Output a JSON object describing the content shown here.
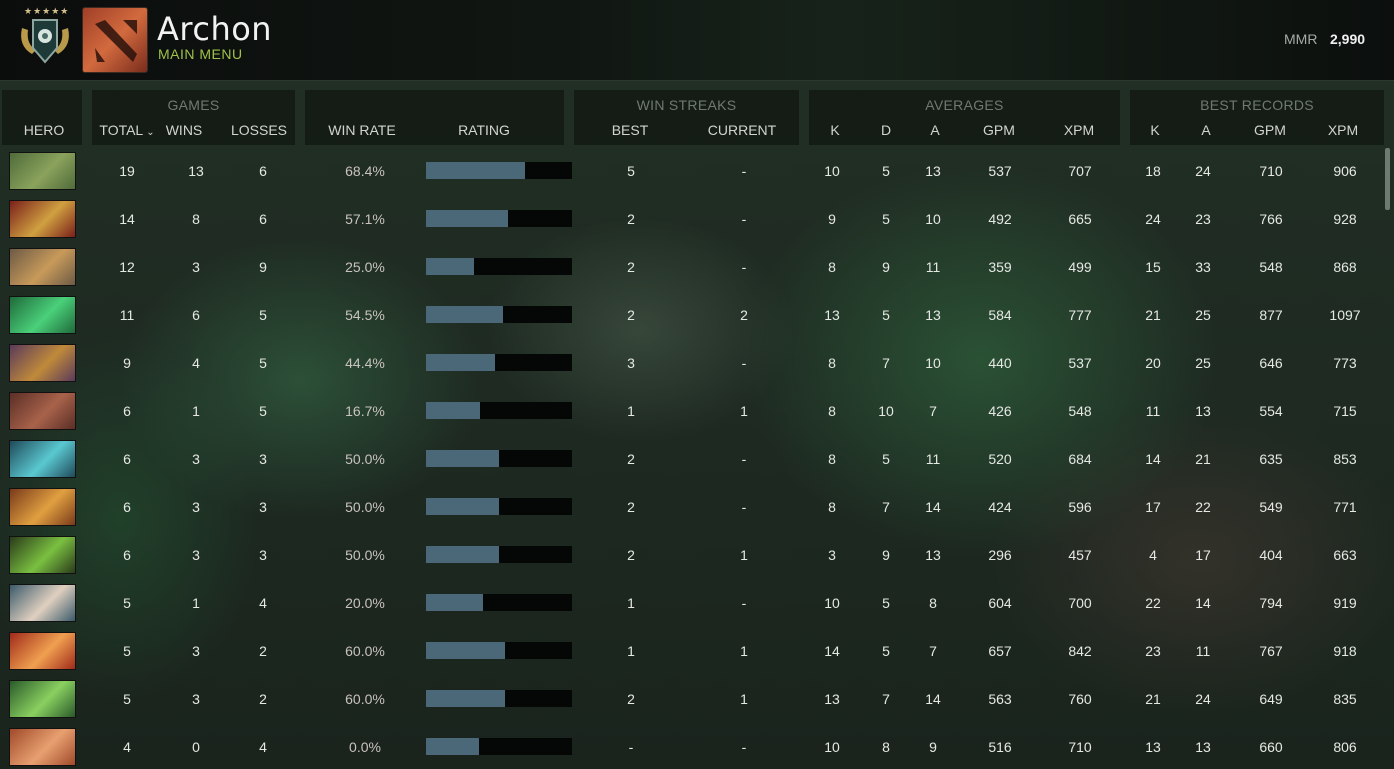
{
  "header": {
    "title": "Archon",
    "subtitle": "MAIN MENU",
    "mmr_label": "MMR",
    "mmr_value": "2,990",
    "rank_badge_icon": "rank-medal-icon",
    "app_icon": "dota-logo-icon"
  },
  "groups": {
    "games": "GAMES",
    "win_streaks": "WIN STREAKS",
    "averages": "AVERAGES",
    "best_records": "BEST RECORDS"
  },
  "columns": {
    "hero": "HERO",
    "total": "TOTAL",
    "wins": "WINS",
    "losses": "LOSSES",
    "win_rate": "WIN RATE",
    "rating": "RATING",
    "best": "BEST",
    "current": "CURRENT",
    "avg_k": "K",
    "avg_d": "D",
    "avg_a": "A",
    "avg_gpm": "GPM",
    "avg_xpm": "XPM",
    "best_k": "K",
    "best_a": "A",
    "best_gpm": "GPM",
    "best_xpm": "XPM"
  },
  "colors": {
    "rating_fill": "#4a6878",
    "accent_green": "#9ec24a"
  },
  "rows": [
    {
      "total": "19",
      "wins": "13",
      "losses": "6",
      "win_rate": "68.4%",
      "rating": 0.68,
      "best": "5",
      "current": "-",
      "k": "10",
      "d": "5",
      "a": "13",
      "gpm": "537",
      "xpm": "707",
      "bk": "18",
      "ba": "24",
      "bgpm": "710",
      "bxpm": "906",
      "portrait": [
        "#4f6b3a",
        "#8aa25c"
      ]
    },
    {
      "total": "14",
      "wins": "8",
      "losses": "6",
      "win_rate": "57.1%",
      "rating": 0.56,
      "best": "2",
      "current": "-",
      "k": "9",
      "d": "5",
      "a": "10",
      "gpm": "492",
      "xpm": "665",
      "bk": "24",
      "ba": "23",
      "bgpm": "766",
      "bxpm": "928",
      "portrait": [
        "#7a1f1a",
        "#d0a040"
      ]
    },
    {
      "total": "12",
      "wins": "3",
      "losses": "9",
      "win_rate": "25.0%",
      "rating": 0.33,
      "best": "2",
      "current": "-",
      "k": "8",
      "d": "9",
      "a": "11",
      "gpm": "359",
      "xpm": "499",
      "bk": "15",
      "ba": "33",
      "bgpm": "548",
      "bxpm": "868",
      "portrait": [
        "#6d5a45",
        "#c89a5a"
      ]
    },
    {
      "total": "11",
      "wins": "6",
      "losses": "5",
      "win_rate": "54.5%",
      "rating": 0.53,
      "best": "2",
      "current": "2",
      "k": "13",
      "d": "5",
      "a": "13",
      "gpm": "584",
      "xpm": "777",
      "bk": "21",
      "ba": "25",
      "bgpm": "877",
      "bxpm": "1097",
      "portrait": [
        "#1f6a3a",
        "#4ad07a"
      ]
    },
    {
      "total": "9",
      "wins": "4",
      "losses": "5",
      "win_rate": "44.4%",
      "rating": 0.47,
      "best": "3",
      "current": "-",
      "k": "8",
      "d": "7",
      "a": "10",
      "gpm": "440",
      "xpm": "537",
      "bk": "20",
      "ba": "25",
      "bgpm": "646",
      "bxpm": "773",
      "portrait": [
        "#5a3a5a",
        "#c08a3a"
      ]
    },
    {
      "total": "6",
      "wins": "1",
      "losses": "5",
      "win_rate": "16.7%",
      "rating": 0.37,
      "best": "1",
      "current": "1",
      "k": "8",
      "d": "10",
      "a": "7",
      "gpm": "426",
      "xpm": "548",
      "bk": "11",
      "ba": "13",
      "bgpm": "554",
      "bxpm": "715",
      "portrait": [
        "#5a2e26",
        "#a8624a"
      ]
    },
    {
      "total": "6",
      "wins": "3",
      "losses": "3",
      "win_rate": "50.0%",
      "rating": 0.5,
      "best": "2",
      "current": "-",
      "k": "8",
      "d": "5",
      "a": "11",
      "gpm": "520",
      "xpm": "684",
      "bk": "14",
      "ba": "21",
      "bgpm": "635",
      "bxpm": "853",
      "portrait": [
        "#1f4a5a",
        "#5ac8d0"
      ]
    },
    {
      "total": "6",
      "wins": "3",
      "losses": "3",
      "win_rate": "50.0%",
      "rating": 0.5,
      "best": "2",
      "current": "-",
      "k": "8",
      "d": "7",
      "a": "14",
      "gpm": "424",
      "xpm": "596",
      "bk": "17",
      "ba": "22",
      "bgpm": "549",
      "bxpm": "771",
      "portrait": [
        "#7a3a1a",
        "#e0a040"
      ]
    },
    {
      "total": "6",
      "wins": "3",
      "losses": "3",
      "win_rate": "50.0%",
      "rating": 0.5,
      "best": "2",
      "current": "1",
      "k": "3",
      "d": "9",
      "a": "13",
      "gpm": "296",
      "xpm": "457",
      "bk": "4",
      "ba": "17",
      "bgpm": "404",
      "bxpm": "663",
      "portrait": [
        "#2a3a1a",
        "#7ac040"
      ]
    },
    {
      "total": "5",
      "wins": "1",
      "losses": "4",
      "win_rate": "20.0%",
      "rating": 0.39,
      "best": "1",
      "current": "-",
      "k": "10",
      "d": "5",
      "a": "8",
      "gpm": "604",
      "xpm": "700",
      "bk": "22",
      "ba": "14",
      "bgpm": "794",
      "bxpm": "919",
      "portrait": [
        "#3a5a6a",
        "#e0d0c0"
      ]
    },
    {
      "total": "5",
      "wins": "3",
      "losses": "2",
      "win_rate": "60.0%",
      "rating": 0.54,
      "best": "1",
      "current": "1",
      "k": "14",
      "d": "5",
      "a": "7",
      "gpm": "657",
      "xpm": "842",
      "bk": "23",
      "ba": "11",
      "bgpm": "767",
      "bxpm": "918",
      "portrait": [
        "#a02a1a",
        "#f0a050"
      ]
    },
    {
      "total": "5",
      "wins": "3",
      "losses": "2",
      "win_rate": "60.0%",
      "rating": 0.54,
      "best": "2",
      "current": "1",
      "k": "13",
      "d": "7",
      "a": "14",
      "gpm": "563",
      "xpm": "760",
      "bk": "21",
      "ba": "24",
      "bgpm": "649",
      "bxpm": "835",
      "portrait": [
        "#2a5a2a",
        "#8ad060"
      ]
    },
    {
      "total": "4",
      "wins": "0",
      "losses": "4",
      "win_rate": "0.0%",
      "rating": 0.36,
      "best": "-",
      "current": "-",
      "k": "10",
      "d": "8",
      "a": "9",
      "gpm": "516",
      "xpm": "710",
      "bk": "13",
      "ba": "13",
      "bgpm": "660",
      "bxpm": "806",
      "portrait": [
        "#a04a2a",
        "#e8a070"
      ]
    }
  ]
}
